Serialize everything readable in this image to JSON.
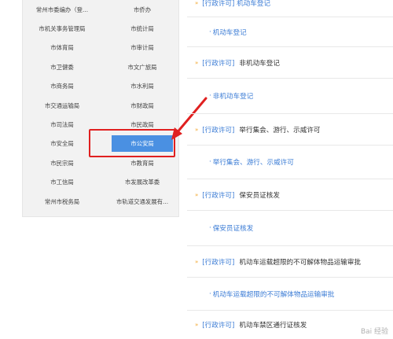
{
  "departments": [
    [
      "常州市委编办（登...",
      "市侨办"
    ],
    [
      "市机关事务管理局",
      "市统计局"
    ],
    [
      "市体育局",
      "市审计局"
    ],
    [
      "市卫健委",
      "市文广旅局"
    ],
    [
      "市商务局",
      "市水利局"
    ],
    [
      "市交通运输局",
      "市财政局"
    ],
    [
      "市司法局",
      "市民政局"
    ],
    [
      "市安全局",
      "市公安局"
    ],
    [
      "市民宗局",
      "市教育局"
    ],
    [
      "市工信局",
      "市发展改革委"
    ],
    [
      "常州市税务局",
      "市轨道交通发展有..."
    ]
  ],
  "selected_department": "市公安局",
  "services": {
    "top_partial": "[行政许可]  机动车登记",
    "tag": "[行政许可]",
    "items": [
      {
        "sub": "机动车登记",
        "title": "非机动车登记"
      },
      {
        "sub": "非机动车登记",
        "title": "举行集会、游行、示威许可"
      },
      {
        "sub": "举行集会、游行、示威许可",
        "title": "保安员证核发"
      },
      {
        "sub": "保安员证核发",
        "title": "机动车运载超限的不可解体物品运输审批"
      },
      {
        "sub": "机动车运载超限的不可解体物品运输审批",
        "title": "机动车禁区通行证核发"
      }
    ]
  },
  "watermark": "Bai 经验"
}
